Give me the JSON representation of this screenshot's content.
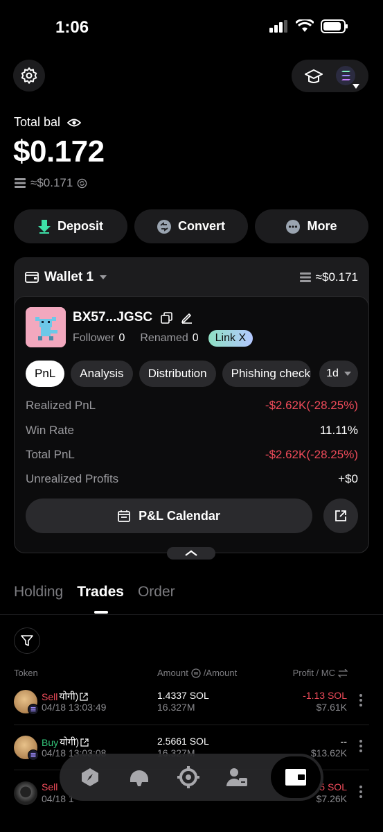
{
  "status": {
    "time": "1:06"
  },
  "balance": {
    "label": "Total bal",
    "value": "$0.172",
    "approx": "≈$0.171"
  },
  "actions": [
    {
      "label": "Deposit",
      "icon": "deposit-arrow-icon"
    },
    {
      "label": "Convert",
      "icon": "convert-icon"
    },
    {
      "label": "More",
      "icon": "more-dots-icon"
    }
  ],
  "wallet": {
    "name": "Wallet 1",
    "approx": "≈$0.171",
    "address": "BX57...JGSC",
    "follower_label": "Follower",
    "follower_count": "0",
    "renamed_label": "Renamed",
    "renamed_count": "0",
    "link_label": "Link X",
    "tabs": [
      "PnL",
      "Analysis",
      "Distribution",
      "Phishing check"
    ],
    "range": "1d",
    "stats": [
      {
        "label": "Realized PnL",
        "value": "-$2.62K(-28.25%)",
        "tone": "neg"
      },
      {
        "label": "Win Rate",
        "value": "11.11%",
        "tone": "neutral"
      },
      {
        "label": "Total PnL",
        "value": "-$2.62K(-28.25%)",
        "tone": "neg"
      },
      {
        "label": "Unrealized Profits",
        "value": "+$0",
        "tone": "neutral"
      }
    ],
    "calendar_label": "P&L Calendar"
  },
  "section_tabs": [
    "Holding",
    "Trades",
    "Order"
  ],
  "table_headers": {
    "token": "Token",
    "amount": "Amount",
    "amount2": "/Amount",
    "profit": "Profit / MC"
  },
  "trades": [
    {
      "side": "Sell",
      "token": "योगी)",
      "date": "04/18 13:03:49",
      "amount": "1.4337 SOL",
      "amount2": "16.327M",
      "profit": "-1.13 SOL",
      "mc": "$7.61K"
    },
    {
      "side": "Buy",
      "token": "योगी)",
      "date": "04/18 13:03:08",
      "amount": "2.5661 SOL",
      "amount2": "16.327M",
      "profit": "--",
      "mc": "$13.62K"
    },
    {
      "side": "Sell",
      "token": "",
      "date": "04/18 1",
      "amount": "",
      "amount2": "",
      "profit": "5 SOL",
      "mc": "$7.26K"
    }
  ],
  "colors": {
    "negative": "#ef4b5a",
    "positive": "#34c77b",
    "card": "#1c1c1e"
  }
}
